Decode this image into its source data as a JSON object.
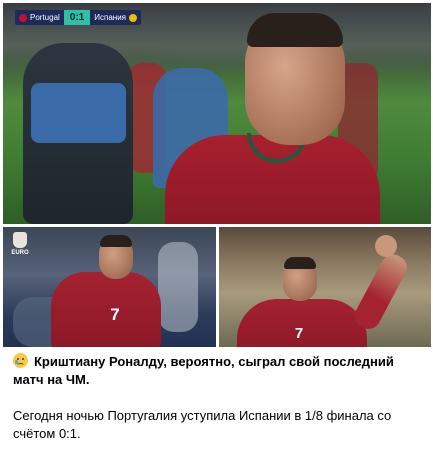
{
  "scorebug": {
    "home_team": "Portugal",
    "away_team": "Испания",
    "score": "0:1",
    "home_flag_color": "#c8102e",
    "away_flag_color": "#f1bf00"
  },
  "photos": {
    "left_badge": "EURO",
    "left_shirt_number": "7",
    "right_shirt_number": "7"
  },
  "post": {
    "emoji_icon": "crying-face-icon",
    "headline": "Криштиану Роналду, вероятно, сыграл свой последний матч на ЧМ.",
    "body": "Сегодня ночью Португалия уступила Испании в 1/8 финала со счётом 0:1."
  },
  "colors": {
    "portugal_red": "#a52231",
    "portugal_green": "#1f5a3f",
    "score_teal": "#2fbfa8"
  }
}
